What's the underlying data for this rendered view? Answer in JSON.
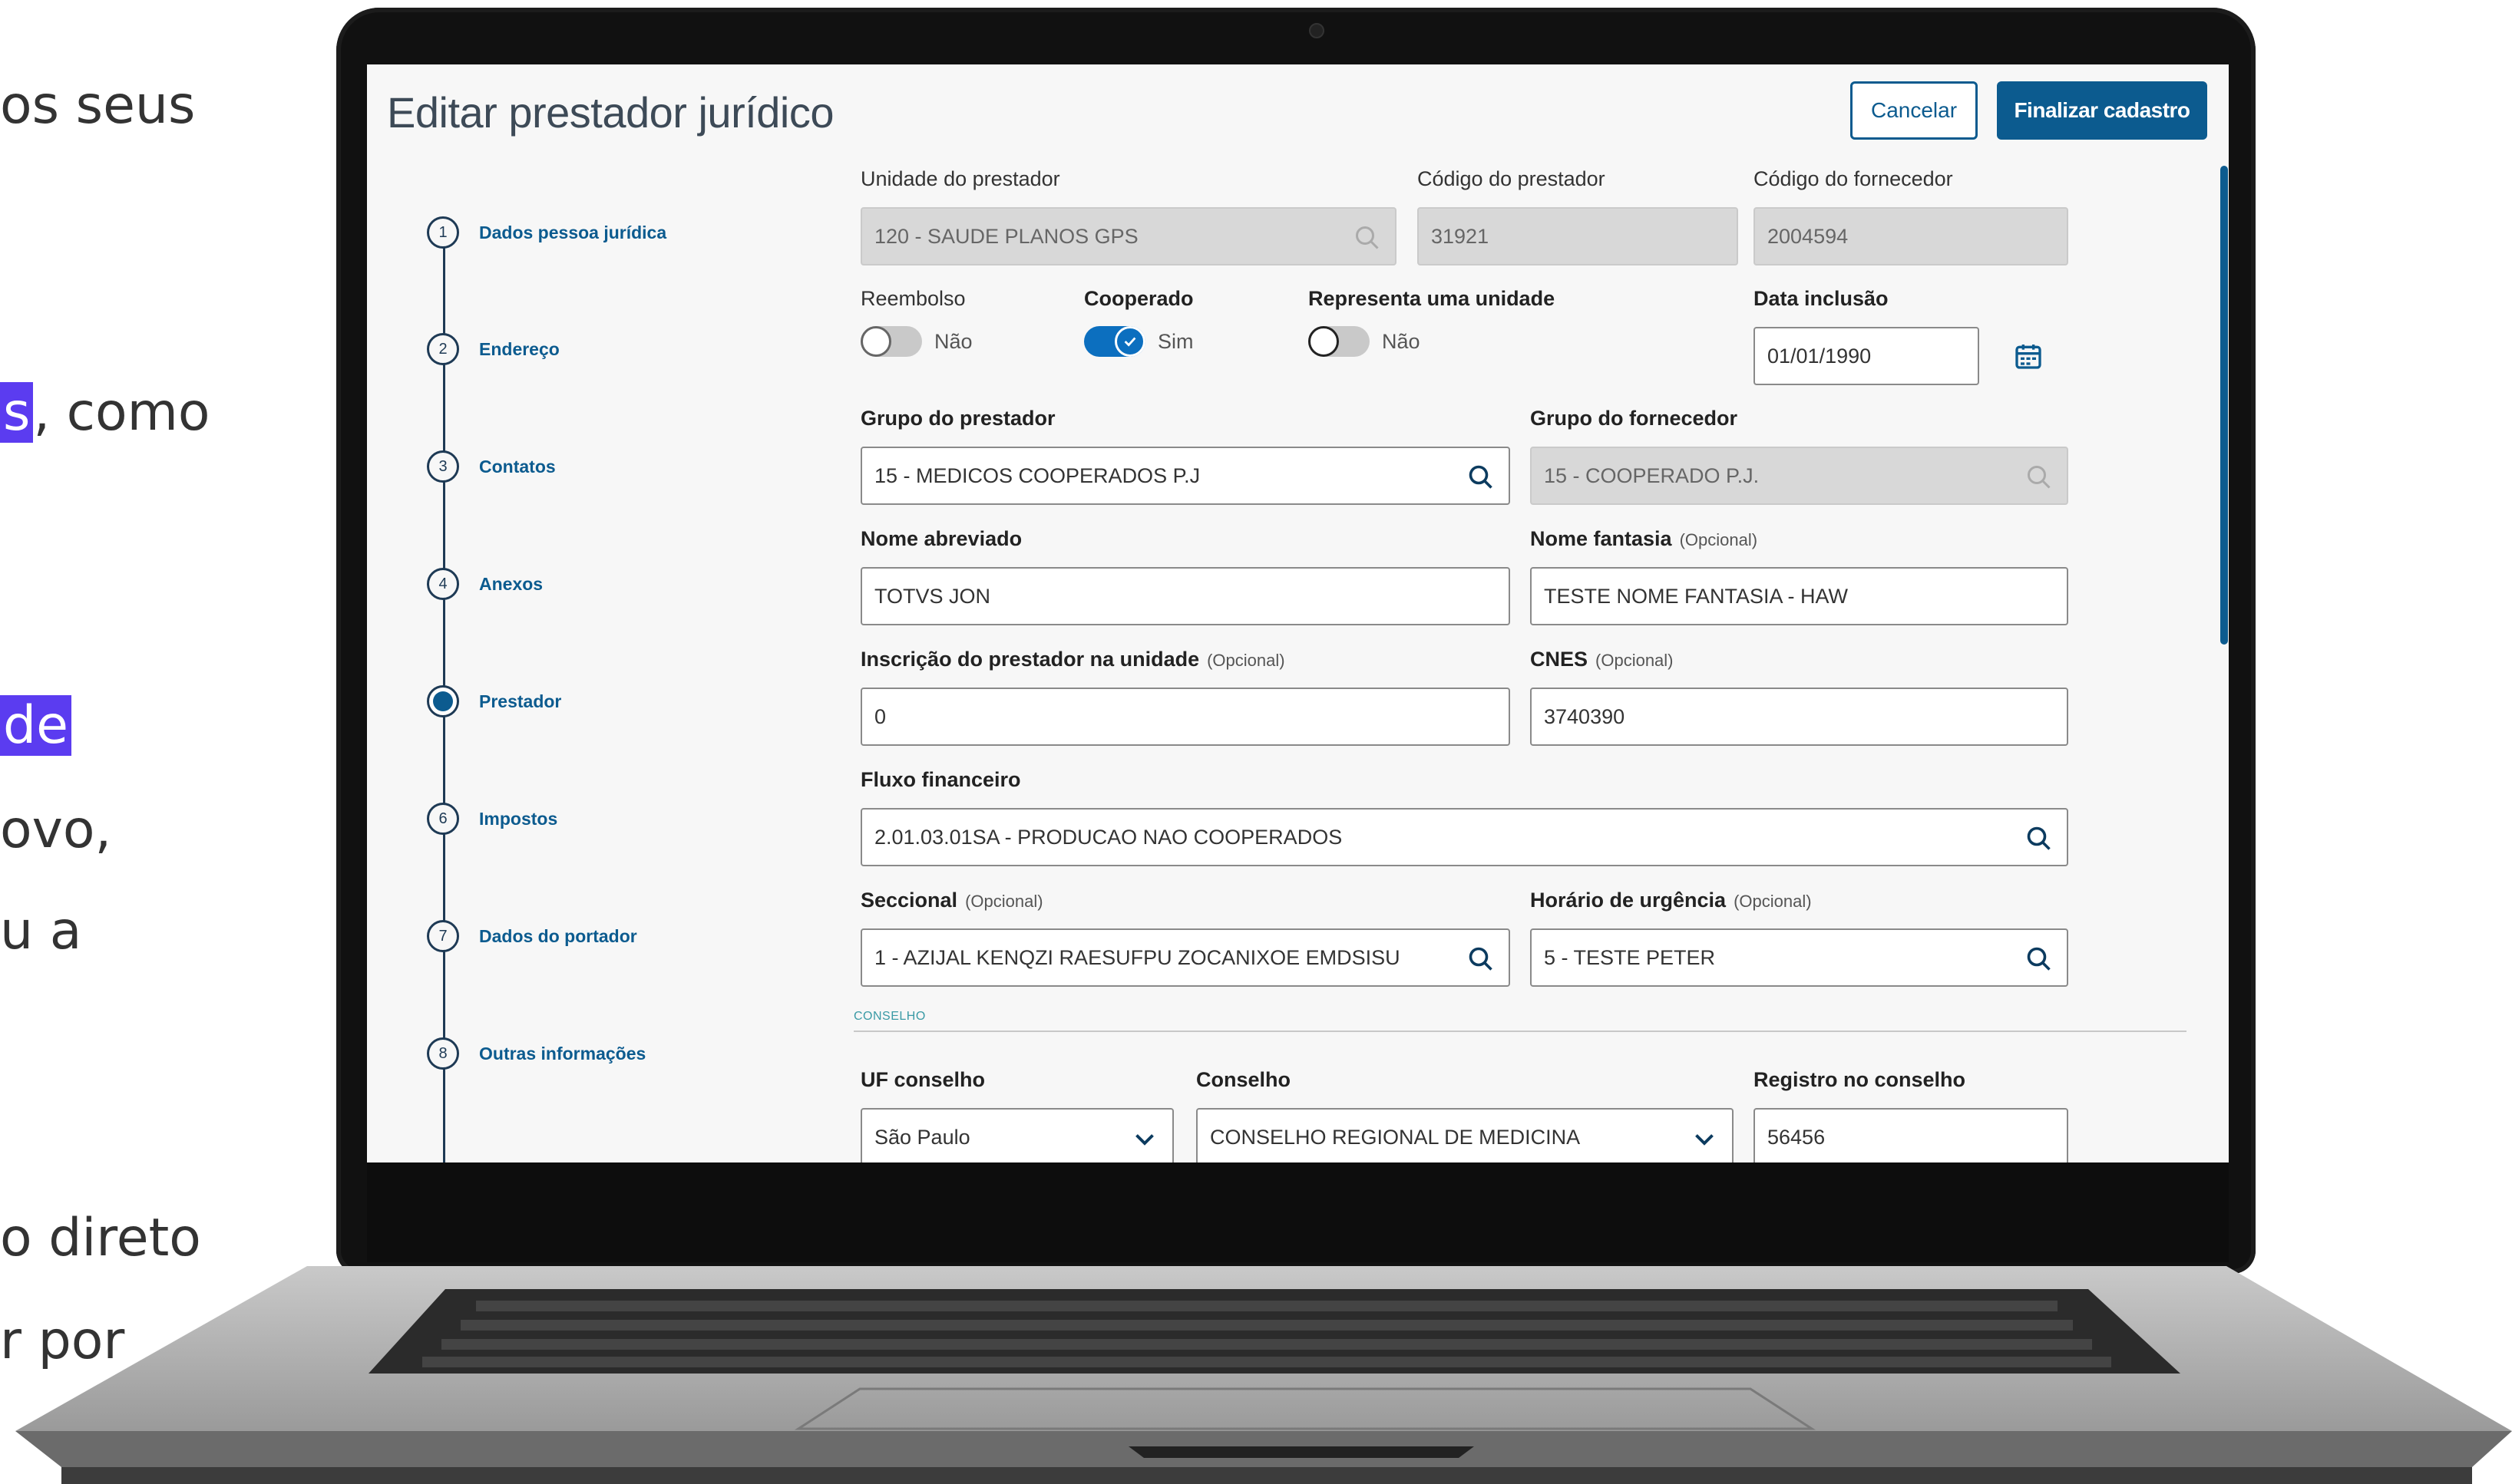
{
  "slide_text": {
    "line1": "os seus",
    "line2_hl": "s",
    "line2_rest": ", como",
    "line3_hl": "de",
    "line4": "ovo,",
    "line5": "u a",
    "line6": "o direto",
    "line7": "r por"
  },
  "app": {
    "title": "Editar prestador jurídico",
    "cancel_label": "Cancelar",
    "finish_label": "Finalizar cadastro"
  },
  "steps": [
    {
      "num": "1",
      "label": "Dados pessoa jurídica"
    },
    {
      "num": "2",
      "label": "Endereço"
    },
    {
      "num": "3",
      "label": "Contatos"
    },
    {
      "num": "4",
      "label": "Anexos"
    },
    {
      "num": "5",
      "label": "Prestador",
      "active": true
    },
    {
      "num": "6",
      "label": "Impostos"
    },
    {
      "num": "7",
      "label": "Dados do portador"
    },
    {
      "num": "8",
      "label": "Outras informações"
    }
  ],
  "form": {
    "unidade_label": "Unidade do prestador",
    "unidade_value": "120 - SAUDE PLANOS GPS",
    "codigo_prestador_label": "Código do prestador",
    "codigo_prestador_value": "31921",
    "codigo_fornecedor_label": "Código do fornecedor",
    "codigo_fornecedor_value": "2004594",
    "reembolso_label": "Reembolso",
    "reembolso_value": "Não",
    "cooperado_label": "Cooperado",
    "cooperado_value": "Sim",
    "representa_label": "Representa uma unidade",
    "representa_value": "Não",
    "data_inclusao_label": "Data inclusão",
    "data_inclusao_value": "01/01/1990",
    "grupo_prestador_label": "Grupo do prestador",
    "grupo_prestador_value": "15 - MEDICOS COOPERADOS P.J",
    "grupo_fornecedor_label": "Grupo do fornecedor",
    "grupo_fornecedor_value": "15 - COOPERADO P.J.",
    "nome_abreviado_label": "Nome abreviado",
    "nome_abreviado_value": "TOTVS JON",
    "nome_fantasia_label": "Nome fantasia",
    "nome_fantasia_value": "TESTE NOME FANTASIA - HAW",
    "optional_tag": "(Opcional)",
    "inscricao_label": "Inscrição do prestador na unidade",
    "inscricao_value": "0",
    "cnes_label": "CNES",
    "cnes_value": "3740390",
    "fluxo_label": "Fluxo financeiro",
    "fluxo_value": "2.01.03.01SA - PRODUCAO NAO COOPERADOS",
    "seccional_label": "Seccional",
    "seccional_value": "1 - AZIJAL KENQZI RAESUFPU ZOCANIXOE EMDSISU",
    "horario_label": "Horário de urgência",
    "horario_value": "5 - TESTE PETER",
    "conselho_section": "CONSELHO",
    "uf_conselho_label": "UF conselho",
    "uf_conselho_value": "São Paulo",
    "conselho_label": "Conselho",
    "conselho_value": "CONSELHO REGIONAL DE MEDICINA",
    "registro_label": "Registro no conselho",
    "registro_value": "56456"
  },
  "colors": {
    "primary": "#0c5b8f",
    "toggle_on": "#0c6fbf",
    "highlight": "#5b3cf0"
  }
}
